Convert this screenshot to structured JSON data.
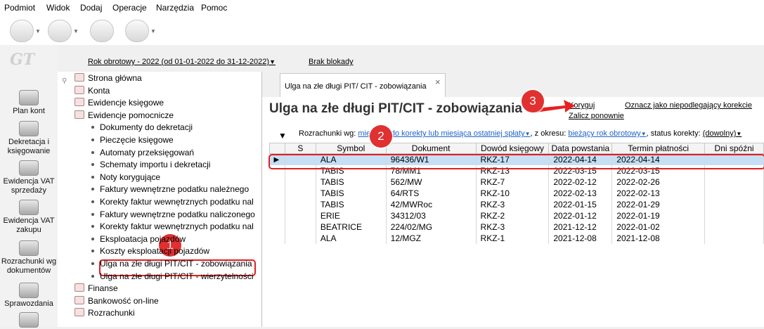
{
  "menubar": {
    "items": [
      "Podmiot",
      "Widok",
      "Dodaj",
      "Operacje",
      "Narzędzia",
      "Pomoc"
    ]
  },
  "toolbar": {
    "icons": [
      "arrow-send-icon",
      "forward-icon",
      "stamp-icon",
      "help-icon"
    ]
  },
  "leftbar": {
    "logo": "GT",
    "items": [
      {
        "label": "Plan kont",
        "icon": "coins-icon"
      },
      {
        "label": "Dekretacja i księgowanie",
        "icon": "pencil-icon"
      },
      {
        "label": "Ewidencja VAT sprzedaży",
        "icon": "coins-icon"
      },
      {
        "label": "Ewidencja VAT zakupu",
        "icon": "coins-icon"
      },
      {
        "label": "Rozrachunki wg dokumentów",
        "icon": "check-icon"
      },
      {
        "label": "Sprawozdania",
        "icon": "coins-icon"
      }
    ]
  },
  "topbar": {
    "fiscal_year": "Rok obrotowy - 2022  (od 01-01-2022 do 31-12-2022)",
    "lock_status": "Brak blokady"
  },
  "tree": {
    "items": [
      {
        "label": "Strona główna",
        "level": 0
      },
      {
        "label": "Konta",
        "level": 0
      },
      {
        "label": "Ewidencje księgowe",
        "level": 0
      },
      {
        "label": "Ewidencje pomocnicze",
        "level": 0
      },
      {
        "label": "Dokumenty do dekretacji",
        "level": 1
      },
      {
        "label": "Pieczęcie księgowe",
        "level": 1
      },
      {
        "label": "Automaty przeksięgowań",
        "level": 1
      },
      {
        "label": "Schematy importu i dekretacji",
        "level": 1
      },
      {
        "label": "Noty korygujące",
        "level": 1
      },
      {
        "label": "Faktury wewnętrzne podatku należnego",
        "level": 1
      },
      {
        "label": "Korekty faktur wewnętrznych podatku nal",
        "level": 1
      },
      {
        "label": "Faktury wewnętrzne podatku naliczonego",
        "level": 1
      },
      {
        "label": "Korekty faktur wewnętrznych podatku nal",
        "level": 1
      },
      {
        "label": "Eksploatacja pojazdów",
        "level": 1
      },
      {
        "label": "Koszty eksploatacji pojazdów",
        "level": 1
      },
      {
        "label": "Ulga na złe długi PIT/CIT - zobowiązania",
        "level": 1
      },
      {
        "label": "Ulga na złe długi PIT/CIT - wierzytelności",
        "level": 1
      },
      {
        "label": "Finanse",
        "level": 0
      },
      {
        "label": "Bankowość on-line",
        "level": 0
      },
      {
        "label": "Rozrachunki",
        "level": 0
      }
    ]
  },
  "tab": {
    "label": "Ulga na złe długi PIT/ CIT - zobowiązania",
    "close": "×"
  },
  "page": {
    "title": "Ulga na złe długi PIT/CIT - zobowiązania",
    "actions": {
      "koryguj": "Koryguj",
      "zalicz": "Zalicz ponownie",
      "oznacz": "Oznacz jako niepodlegający korekcie"
    }
  },
  "filter": {
    "label1": "Rozrachunki wg:",
    "value1": "miesiąca do korekty lub miesiąca ostatniej spłaty",
    "label2": ", z okresu:",
    "value2": "bieżący rok obrotowy",
    "label3": ", status korekty:",
    "value3": "(dowolny)"
  },
  "grid": {
    "columns": [
      "",
      "S",
      "Symbol",
      "Dokument",
      "Dowód księgowy",
      "Data powstania",
      "Termin płatności",
      "Dni spóźni"
    ],
    "rows": [
      [
        "ALA",
        "96436/W1",
        "RKZ-17",
        "2022-04-14",
        "2022-04-14"
      ],
      [
        "TABIS",
        "78/MM1",
        "RKZ-13",
        "2022-03-15",
        "2022-03-15"
      ],
      [
        "TABIS",
        "562/MW",
        "RKZ-7",
        "2022-02-12",
        "2022-02-26"
      ],
      [
        "TABIS",
        "64/RTS",
        "RKZ-10",
        "2022-02-13",
        "2022-02-13"
      ],
      [
        "TABIS",
        "42/MWRoc",
        "RKZ-3",
        "2022-01-15",
        "2022-01-29"
      ],
      [
        "ERIE",
        "34312/03",
        "RKZ-2",
        "2022-01-12",
        "2022-01-19"
      ],
      [
        "BEATRICE",
        "224/02/MG",
        "RKZ-3",
        "2021-12-12",
        "2022-01-02"
      ],
      [
        "ALA",
        "12/MGZ",
        "RKZ-1",
        "2021-12-08",
        "2021-12-08"
      ]
    ]
  },
  "annotations": {
    "badge1": "1",
    "badge2": "2",
    "badge3": "3"
  },
  "colors": {
    "highlight": "#e02020",
    "selection": "#c6dff5",
    "link": "#1f63c8"
  }
}
